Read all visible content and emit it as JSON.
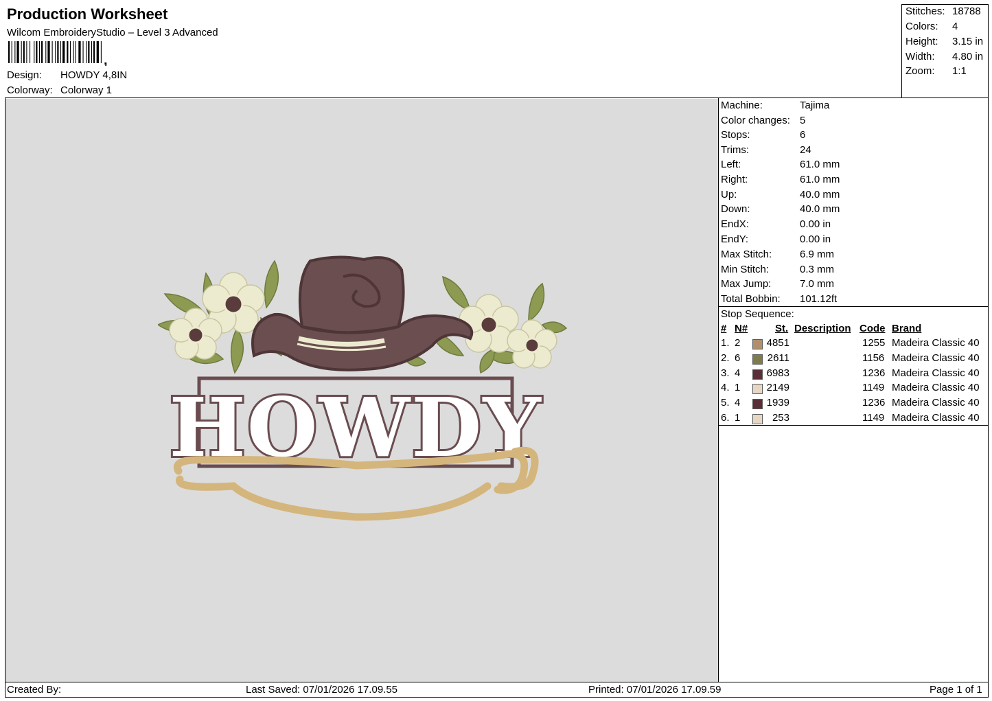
{
  "header": {
    "title": "Production Worksheet",
    "subtitle": "Wilcom EmbroideryStudio – Level 3 Advanced",
    "design_label": "Design:",
    "design_value": "HOWDY 4,8IN",
    "colorway_label": "Colorway:",
    "colorway_value": "Colorway 1"
  },
  "summary": [
    {
      "label": "Stitches:",
      "value": "18788"
    },
    {
      "label": "Colors:",
      "value": "4"
    },
    {
      "label": "Height:",
      "value": "3.15 in"
    },
    {
      "label": "Width:",
      "value": "4.80 in"
    },
    {
      "label": "Zoom:",
      "value": "1:1"
    }
  ],
  "machine_info": [
    {
      "label": "Machine:",
      "value": "Tajima"
    },
    {
      "label": "Color changes:",
      "value": "5"
    },
    {
      "label": "Stops:",
      "value": "6"
    },
    {
      "label": "Trims:",
      "value": "24"
    },
    {
      "label": "Left:",
      "value": "61.0 mm"
    },
    {
      "label": "Right:",
      "value": "61.0 mm"
    },
    {
      "label": "Up:",
      "value": "40.0 mm"
    },
    {
      "label": "Down:",
      "value": "40.0 mm"
    },
    {
      "label": "EndX:",
      "value": "0.00 in"
    },
    {
      "label": "EndY:",
      "value": "0.00 in"
    },
    {
      "label": "Max Stitch:",
      "value": "6.9 mm"
    },
    {
      "label": "Min Stitch:",
      "value": "0.3 mm"
    },
    {
      "label": "Max Jump:",
      "value": "7.0 mm"
    },
    {
      "label": "Total Bobbin:",
      "value": "101.12ft"
    }
  ],
  "stop_sequence": {
    "title": "Stop Sequence:",
    "headers": {
      "idx": "#",
      "n": "N#",
      "st": "St.",
      "desc": "Description",
      "code": "Code",
      "brand": "Brand"
    },
    "rows": [
      {
        "idx": "1.",
        "n": "2",
        "color": "#b08e6e",
        "st": "4851",
        "code": "1255",
        "brand": "Madeira Classic 40"
      },
      {
        "idx": "2.",
        "n": "6",
        "color": "#7d7c4a",
        "st": "2611",
        "code": "1156",
        "brand": "Madeira Classic 40"
      },
      {
        "idx": "3.",
        "n": "4",
        "color": "#5a2e38",
        "st": "6983",
        "code": "1236",
        "brand": "Madeira Classic 40"
      },
      {
        "idx": "4.",
        "n": "1",
        "color": "#e8d6c4",
        "st": "2149",
        "code": "1149",
        "brand": "Madeira Classic 40"
      },
      {
        "idx": "5.",
        "n": "4",
        "color": "#5a2e38",
        "st": "1939",
        "code": "1236",
        "brand": "Madeira Classic 40"
      },
      {
        "idx": "6.",
        "n": "1",
        "color": "#e8d6c4",
        "st": "253",
        "code": "1149",
        "brand": "Madeira Classic 40"
      }
    ]
  },
  "design_art": {
    "word": "HOWDY",
    "colors": {
      "hat": "#6b4e4f",
      "hat_dark": "#4e3537",
      "leaf": "#8c9a52",
      "flower": "#ecebd0",
      "flower_center": "#5a3c3c",
      "rope": "#d4b57c",
      "rope_dark": "#a88a4e",
      "letters": "#6a4c50",
      "background": "#dcdcdc"
    }
  },
  "footer": {
    "created_by": "Created By:",
    "last_saved": "Last Saved: 07/01/2026 17.09.55",
    "printed": "Printed: 07/01/2026 17.09.59",
    "page": "Page 1 of 1"
  }
}
